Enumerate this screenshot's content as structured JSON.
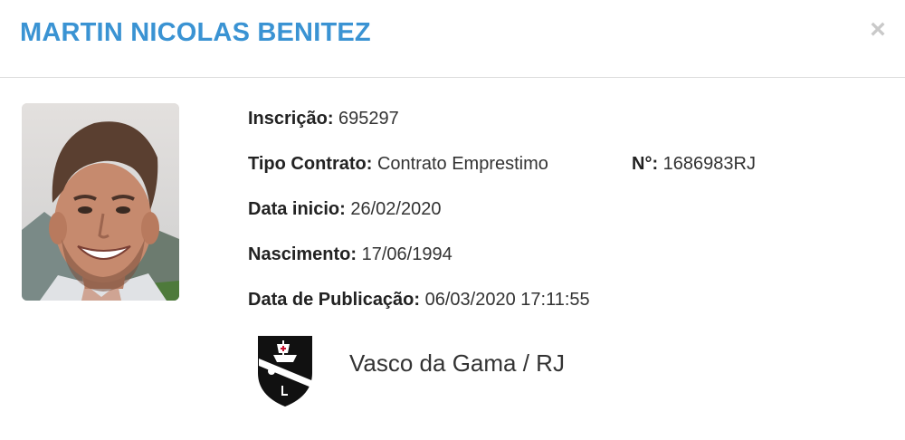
{
  "header": {
    "player_name": "MARTIN NICOLAS BENITEZ",
    "close_symbol": "×"
  },
  "photo": {
    "icon": "player-photo"
  },
  "details": {
    "inscricao": {
      "label": "Inscrição:",
      "value": "695297"
    },
    "tipo_contrato": {
      "label": "Tipo Contrato:",
      "value": "Contrato Emprestimo"
    },
    "numero": {
      "label": "N°:",
      "value": "1686983RJ"
    },
    "data_inicio": {
      "label": "Data inicio:",
      "value": "26/02/2020"
    },
    "nascimento": {
      "label": "Nascimento:",
      "value": "17/06/1994"
    },
    "data_publicacao": {
      "label": "Data de Publicação:",
      "value": "06/03/2020 17:11:55"
    }
  },
  "club": {
    "name": "Vasco da Gama / RJ",
    "logo_icon": "vasco-da-gama-crest"
  },
  "colors": {
    "title": "#3a93d3",
    "close": "#c9c9c9",
    "divider": "#dcdcdc"
  }
}
